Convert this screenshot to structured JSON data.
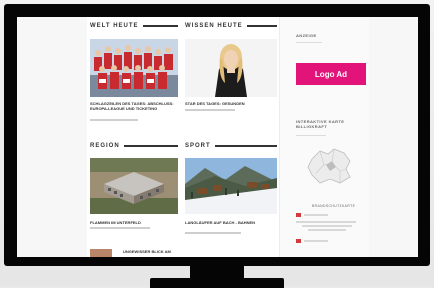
{
  "sections": {
    "welt": "WELT HEUTE",
    "wissen": "WISSEN HEUTE",
    "region": "REGION",
    "sport": "SPORT"
  },
  "articles": [
    {
      "caption": "SCHLAGZEILEN DES TAGES: ABSCHLUSS: EUROPA-LEAGUE UND TICKETING"
    },
    {
      "caption": "STAR DES TAGES: GESUNDEN"
    },
    {
      "caption": "FLAMMEN IM UNTERFELD"
    },
    {
      "caption": "LANGLÄUFER AUF BACH - BAHNEN"
    },
    {
      "caption": "UNGEWISSER BLICK AM"
    }
  ],
  "sidebar": {
    "anzeige": "ANZEIGE",
    "ad_label": "Logo Ad",
    "map_title": "INTERAKTIVE KARTE BILLIGKRAFT",
    "map_sub": "BRANDSCHUTZKARTE"
  },
  "colors": {
    "ad": "#e2147a",
    "monitor": "#050505"
  }
}
